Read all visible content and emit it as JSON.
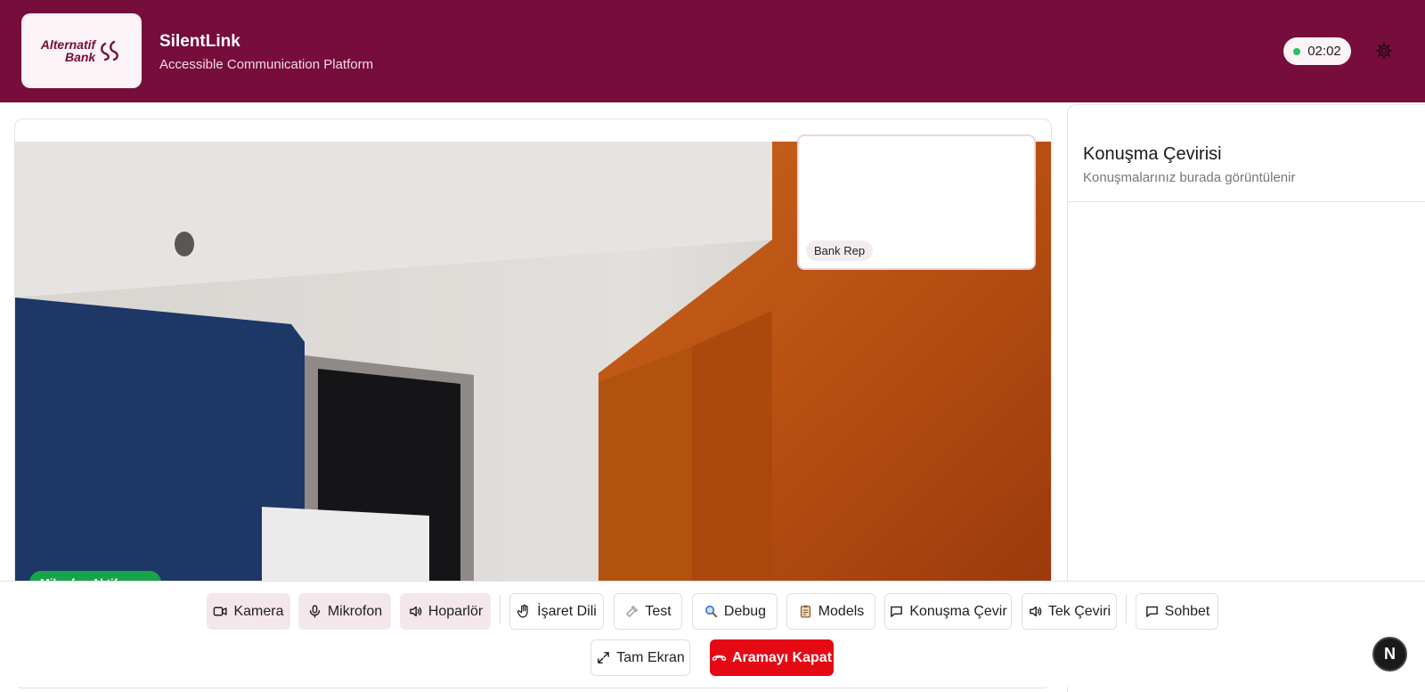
{
  "header": {
    "logo_line1": "Alternatif",
    "logo_line2": "Bank",
    "title": "SilentLink",
    "subtitle": "Accessible Communication Platform",
    "timer": "02:02",
    "status_color": "#22c55e",
    "brand_color": "#760d3a"
  },
  "video": {
    "remote_label": "Bank Rep",
    "mic_badge": "Mikrofon Aktif"
  },
  "side_panel": {
    "title": "Konuşma Çevirisi",
    "subtitle": "Konuşmalarınız burada görüntülenir"
  },
  "controls": {
    "camera": "Kamera",
    "microphone": "Mikrofon",
    "speaker": "Hoparlör",
    "sign_language": "İşaret Dili",
    "test": "Test",
    "debug": "Debug",
    "models": "Models",
    "speech_translate": "Konuşma Çevir",
    "single_translate": "Tek Çeviri",
    "chat": "Sohbet",
    "fullscreen": "Tam Ekran",
    "end_call": "Aramayı Kapat"
  },
  "corner_badge": "N",
  "icons": [
    "camera-icon",
    "mic-icon",
    "speaker-icon",
    "hand-icon",
    "wrench-icon",
    "magnifier-icon",
    "clipboard-icon",
    "chat-bubble-icon",
    "expand-icon",
    "phone-hangup-icon",
    "gear-icon"
  ]
}
